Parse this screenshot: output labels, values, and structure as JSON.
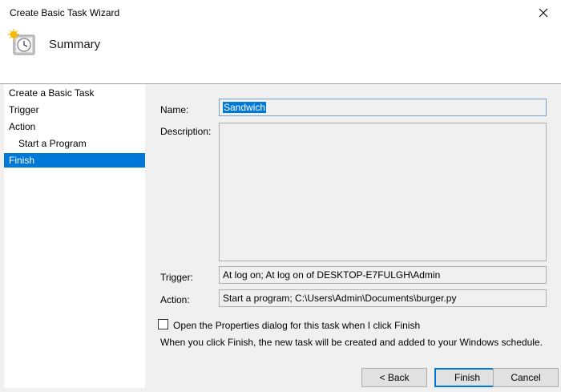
{
  "window": {
    "title": "Create Basic Task Wizard"
  },
  "header": {
    "title": "Summary"
  },
  "nav": {
    "items": [
      {
        "label": "Create a Basic Task"
      },
      {
        "label": "Trigger"
      },
      {
        "label": "Action"
      },
      {
        "label": "Start a Program"
      },
      {
        "label": "Finish"
      }
    ]
  },
  "form": {
    "name_label": "Name:",
    "name_value": "Sandwich",
    "description_label": "Description:",
    "description_value": "",
    "trigger_label": "Trigger:",
    "trigger_value": "At log on; At log on of DESKTOP-E7FULGH\\Admin",
    "action_label": "Action:",
    "action_value": "Start a program; C:\\Users\\Admin\\Documents\\burger.py",
    "open_properties_label": "Open the Properties dialog for this task when I click Finish",
    "open_properties_checked": false,
    "info_text": "When you click Finish, the new task will be created and added to your Windows schedule."
  },
  "buttons": {
    "back": "< Back",
    "finish": "Finish",
    "cancel": "Cancel"
  },
  "colors": {
    "selection": "#0078d7",
    "window_bg": "#f0f0f0"
  }
}
